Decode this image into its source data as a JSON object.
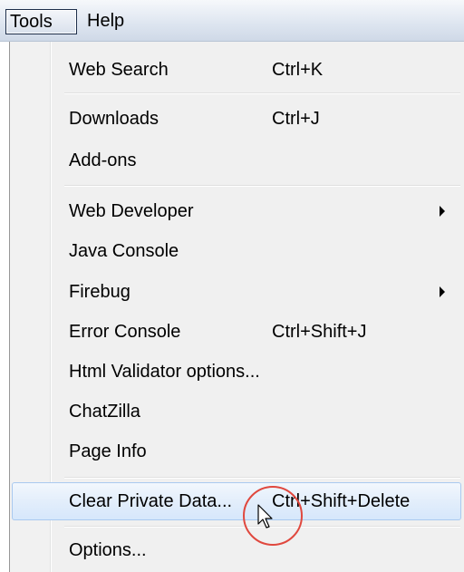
{
  "menubar": {
    "tools_label": "Tools",
    "help_label": "Help"
  },
  "menu": {
    "items": [
      {
        "label": "Web Search",
        "shortcut": "Ctrl+K"
      },
      {
        "label": "Downloads",
        "shortcut": "Ctrl+J"
      },
      {
        "label": "Add-ons",
        "shortcut": ""
      },
      {
        "label": "Web Developer",
        "shortcut": "",
        "submenu": true
      },
      {
        "label": "Java Console",
        "shortcut": ""
      },
      {
        "label": "Firebug",
        "shortcut": "",
        "submenu": true
      },
      {
        "label": "Error Console",
        "shortcut": "Ctrl+Shift+J"
      },
      {
        "label": "Html Validator options...",
        "shortcut": ""
      },
      {
        "label": "ChatZilla",
        "shortcut": ""
      },
      {
        "label": "Page Info",
        "shortcut": ""
      },
      {
        "label": "Clear Private Data...",
        "shortcut": "Ctrl+Shift+Delete",
        "highlighted": true
      },
      {
        "label": "Options...",
        "shortcut": ""
      }
    ]
  },
  "colors": {
    "highlight_border": "#a9c9ef",
    "click_circle": "#e0483e",
    "menu_background": "#f0f0f0"
  }
}
